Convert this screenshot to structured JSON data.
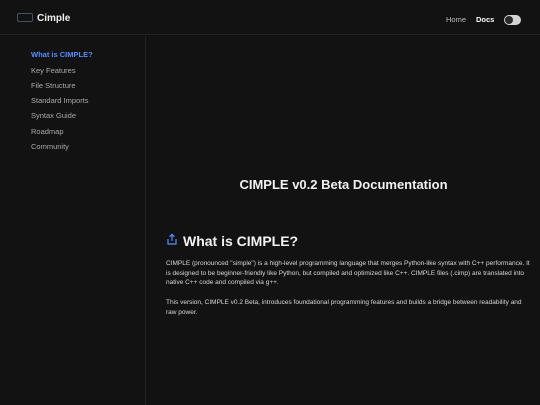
{
  "header": {
    "brand": "Cimple",
    "nav": {
      "home": "Home",
      "docs": "Docs"
    },
    "theme_toggle": "on"
  },
  "sidebar": {
    "items": [
      {
        "label": "What is CIMPLE?",
        "active": true
      },
      {
        "label": "Key Features"
      },
      {
        "label": "File Structure"
      },
      {
        "label": "Standard Imports"
      },
      {
        "label": "Syntax Guide"
      },
      {
        "label": "Roadmap"
      },
      {
        "label": "Community"
      }
    ]
  },
  "main": {
    "title": "CIMPLE v0.2 Beta Documentation",
    "section": {
      "icon": "share-icon",
      "heading": "What is CIMPLE?",
      "paragraphs": [
        "CIMPLE (pronounced \"simple\") is a high-level programming language that merges Python-like syntax with C++ performance. It is designed to be beginner-friendly like Python, but compiled and optimized like C++. CIMPLE files (.cimp) are translated into native C++ code and compiled via g++.",
        "This version, CIMPLE v0.2 Beta, introduces foundational programming features and builds a bridge between readability and raw power."
      ]
    }
  },
  "colors": {
    "background": "#121212",
    "accent": "#5b8cff",
    "text": "#e8e8e8"
  }
}
